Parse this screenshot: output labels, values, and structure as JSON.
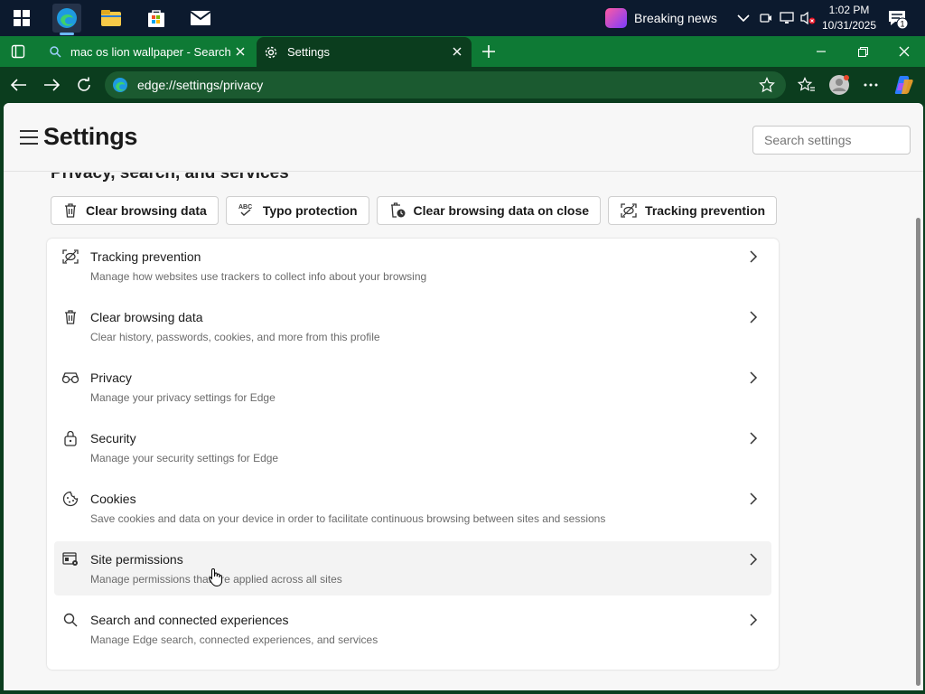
{
  "taskbar": {
    "news_label": "Breaking news",
    "time": "1:02 PM",
    "date": "10/31/2025",
    "notification_count": "1"
  },
  "tabs": [
    {
      "label": "mac os lion wallpaper - Search"
    },
    {
      "label": "Settings"
    }
  ],
  "address": {
    "url": "edge://settings/privacy"
  },
  "header": {
    "title": "Settings",
    "search_placeholder": "Search settings"
  },
  "section": {
    "title": "Privacy, search, and services"
  },
  "quick_actions": [
    {
      "label": "Clear browsing data",
      "icon": "trash-icon"
    },
    {
      "label": "Typo protection",
      "icon": "spellcheck-icon"
    },
    {
      "label": "Clear browsing data on close",
      "icon": "trash-clock-icon"
    },
    {
      "label": "Tracking prevention",
      "icon": "tracking-icon"
    }
  ],
  "settings_rows": [
    {
      "title": "Tracking prevention",
      "desc": "Manage how websites use trackers to collect info about your browsing",
      "icon": "tracking-icon"
    },
    {
      "title": "Clear browsing data",
      "desc": "Clear history, passwords, cookies, and more from this profile",
      "icon": "trash-icon"
    },
    {
      "title": "Privacy",
      "desc": "Manage your privacy settings for Edge",
      "icon": "glasses-icon"
    },
    {
      "title": "Security",
      "desc": "Manage your security settings for Edge",
      "icon": "lock-icon"
    },
    {
      "title": "Cookies",
      "desc": "Save cookies and data on your device in order to facilitate continuous browsing between sites and sessions",
      "icon": "cookie-icon"
    },
    {
      "title": "Site permissions",
      "desc": "Manage permissions that are applied across all sites",
      "icon": "site-permissions-icon"
    },
    {
      "title": "Search and connected experiences",
      "desc": "Manage Edge search, connected experiences, and services",
      "icon": "search-icon"
    }
  ],
  "colors": {
    "taskbar": "#0c1a2e",
    "tabbar": "#0e7a35",
    "toolbar": "#0b3d1e",
    "page": "#f7f7f7"
  }
}
